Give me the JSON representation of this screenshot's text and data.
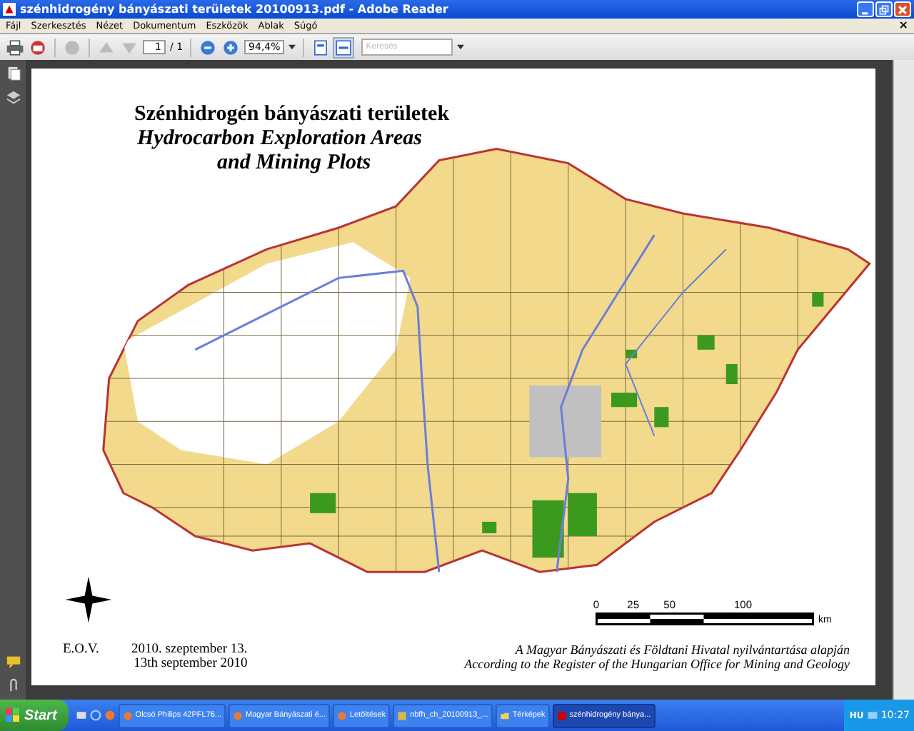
{
  "window": {
    "title": "szénhidrogény bányászati területek 20100913.pdf - Adobe Reader"
  },
  "menu": [
    "Fájl",
    "Szerkesztés",
    "Nézet",
    "Dokumentum",
    "Eszközök",
    "Ablak",
    "Súgó"
  ],
  "menu_close": "×",
  "toolbar": {
    "page": "1",
    "page_total": "/ 1",
    "zoom": "94,4%",
    "search": {
      "placeholder": "Keresés"
    }
  },
  "document": {
    "title_hu": "Szénhidrogén bányászati területek",
    "title_en": [
      "Hydrocarbon Exploration Areas",
      "and Mining Plots"
    ],
    "scale": {
      "labels": [
        "0",
        "25",
        "50",
        "100"
      ],
      "unit": "km"
    },
    "projection": "E.O.V.",
    "date_hu": "2010. szeptember 13.",
    "date_en": "13th september 2010",
    "source_hu": "A Magyar Bányászati és Földtani Hivatal nyilvántartása alapján",
    "source_en": "According to the Register of the Hungarian Office for Mining and Geology"
  },
  "taskbar": {
    "start": "Start",
    "tasks": [
      {
        "label": "Olcsó Philips 42PFL76...",
        "kind": "browser",
        "selected": false
      },
      {
        "label": "Magyar Bányászati é...",
        "kind": "browser",
        "selected": false
      },
      {
        "label": "Letöltések",
        "kind": "browser",
        "selected": false
      },
      {
        "label": "nbfh_ch_20100913_...",
        "kind": "archive",
        "selected": false
      },
      {
        "label": "Térképek",
        "kind": "folder",
        "selected": false
      },
      {
        "label": "szénhidrogény bánya...",
        "kind": "pdf",
        "selected": true
      }
    ],
    "language": "HU",
    "clock": "10:27"
  }
}
